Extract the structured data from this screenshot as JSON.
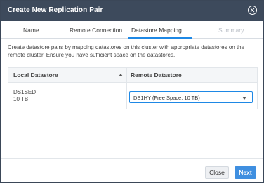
{
  "dialog": {
    "title": "Create New Replication Pair",
    "close_icon": "close-circle-icon"
  },
  "tabs": [
    {
      "label": "Name",
      "state": "normal"
    },
    {
      "label": "Remote Connection",
      "state": "normal"
    },
    {
      "label": "Datastore Mapping",
      "state": "active"
    },
    {
      "label": "Summary",
      "state": "disabled"
    }
  ],
  "description": "Create datastore pairs by mapping datastores on this cluster with appropriate datastores on the remote cluster. Ensure you have sufficient space on the datastores.",
  "table": {
    "headers": {
      "local": "Local Datastore",
      "remote": "Remote Datastore"
    },
    "sort_icon": "sort-up-icon",
    "rows": [
      {
        "local_name": "DS1SED",
        "local_size": "10 TB",
        "remote_selected": "DS1HY (Free Space: 10 TB)"
      }
    ]
  },
  "footer": {
    "close_label": "Close",
    "next_label": "Next"
  },
  "colors": {
    "titlebar": "#3d4a5c",
    "accent": "#1e88e5",
    "primary_button": "#3f8fe0"
  }
}
